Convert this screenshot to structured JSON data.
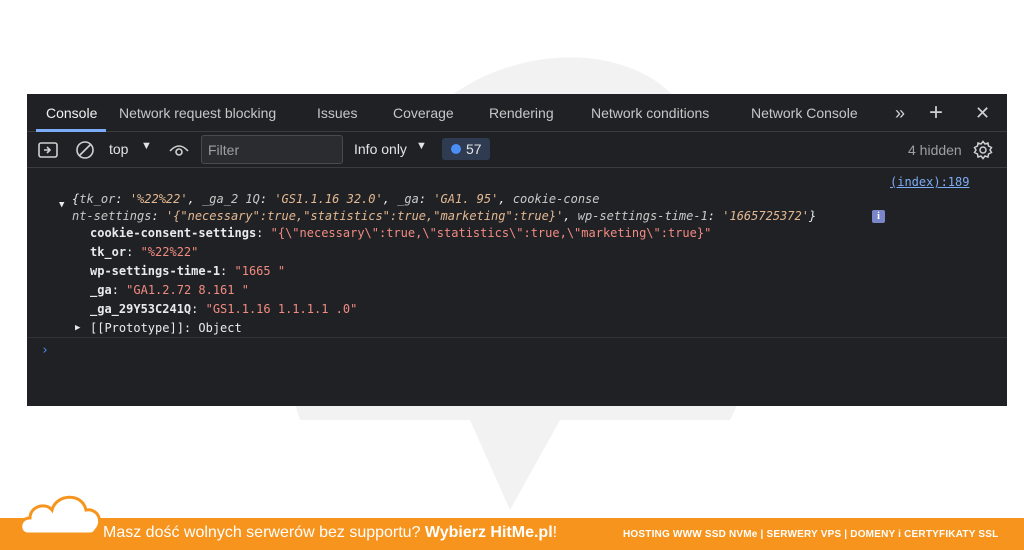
{
  "devtools": {
    "tabs": [
      {
        "label": "Console",
        "active": true
      },
      {
        "label": "Network request blocking"
      },
      {
        "label": "Issues"
      },
      {
        "label": "Coverage"
      },
      {
        "label": "Rendering"
      },
      {
        "label": "Network conditions"
      },
      {
        "label": "Network Console"
      }
    ],
    "more_tabs_icon": "chevron-double-right",
    "add_icon": "plus",
    "close_icon": "close"
  },
  "toolbar": {
    "context_select": "top",
    "filter_placeholder": "Filter",
    "level_select": "Info only",
    "message_count": "57",
    "hidden_count": "4 hidden"
  },
  "console": {
    "source": "(index):189",
    "summary_line1": {
      "open": "{",
      "k1": "tk_or",
      "v1": "'%22%22'",
      "k2": "_ga_2",
      "k2b": "1Q",
      "v2a": "'GS1.1.16",
      "v2b": "32.0'",
      "k3": "_ga",
      "v3a": "'GA1.",
      "v3b": "95'",
      "tail": "cookie-conse"
    },
    "summary_line2": {
      "pre": "nt-settings",
      "v": "'{\"necessary\":true,\"statistics\":true,\"marketing\":true}'",
      "k": "wp-settings-time-1",
      "v2": "'1665725372'",
      "close": "}"
    },
    "props": [
      {
        "key": "cookie-consent-settings",
        "value": "\"{\\\"necessary\\\":true,\\\"statistics\\\":true,\\\"marketing\\\":true}\""
      },
      {
        "key": "tk_or",
        "value": "\"%22%22\""
      },
      {
        "key": "wp-settings-time-1",
        "value": "\"1665      \""
      },
      {
        "key": "_ga",
        "value": "\"GA1.2.72      8.161       \""
      },
      {
        "key": "_ga_29Y53C241Q",
        "value": "\"GS1.1.16       1.1.1.1         .0\""
      }
    ],
    "prototype_key": "[[Prototype]]",
    "prototype_value": "Object"
  },
  "footer": {
    "message_prefix": "Masz dość wolnych serwerów bez supportu? ",
    "message_cta": "Wybierz HitMe.pl",
    "message_suffix": "!",
    "services": "HOSTING WWW SSD NVMe | SERWERY VPS | DOMENY i CERTYFIKATY SSL"
  },
  "colors": {
    "panel_bg": "#202124",
    "accent_blue": "#7cacf8",
    "footer_orange": "#f7941d"
  }
}
